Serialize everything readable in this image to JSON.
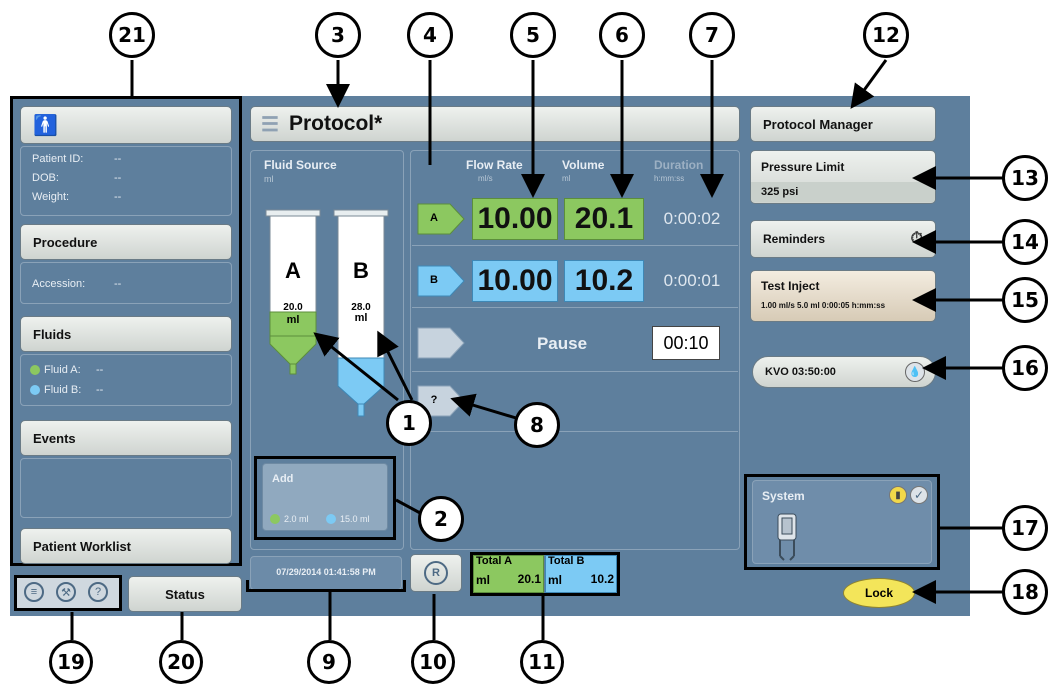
{
  "colors": {
    "screen_bg": "#5e7f9d",
    "fluid_a": "#8cc860",
    "fluid_b": "#7ccaf4",
    "lock": "#f3e55a"
  },
  "callouts": [
    "21",
    "3",
    "4",
    "5",
    "6",
    "7",
    "12",
    "13",
    "14",
    "15",
    "16",
    "17",
    "18",
    "1",
    "8",
    "2",
    "19",
    "20",
    "9",
    "10",
    "11"
  ],
  "header": {
    "title": "Protocol*",
    "protocol_manager": "Protocol Manager"
  },
  "patient": {
    "id_label": "Patient ID:",
    "id_value": "--",
    "dob_label": "DOB:",
    "dob_value": "--",
    "weight_label": "Weight:",
    "weight_value": "--",
    "procedure": "Procedure",
    "accession_label": "Accession:",
    "accession_value": "--",
    "fluids": "Fluids",
    "fluid_a_label": "Fluid A:",
    "fluid_a_value": "--",
    "fluid_b_label": "Fluid B:",
    "fluid_b_value": "--",
    "events": "Events",
    "worklist": "Patient Worklist"
  },
  "fluid_source": {
    "title": "Fluid Source",
    "unit": "ml",
    "syringe_a": {
      "letter": "A",
      "volume": "20.0",
      "unit": "ml",
      "fill_fraction": 0.45
    },
    "syringe_b": {
      "letter": "B",
      "volume": "28.0",
      "unit": "ml",
      "fill_fraction": 0.35
    },
    "add": {
      "label": "Add",
      "a": "2.0 ml",
      "b": "15.0 ml"
    }
  },
  "table": {
    "flow_rate": "Flow Rate",
    "flow_unit": "ml/s",
    "volume": "Volume",
    "volume_unit": "ml",
    "duration": "Duration",
    "duration_unit": "h:mm:ss",
    "row_a": {
      "tag": "A",
      "flow": "10.00",
      "volume": "20.1",
      "duration": "0:00:02"
    },
    "row_b": {
      "tag": "B",
      "flow": "10.00",
      "volume": "10.2",
      "duration": "0:00:01"
    },
    "pause": {
      "label": "Pause",
      "time": "00:10"
    },
    "unknown": {
      "tag": "?"
    }
  },
  "footer": {
    "datetime": "07/29/2014 01:41:58 PM",
    "r": "R",
    "total_a": "Total A",
    "total_a_unit": "ml",
    "total_a_value": "20.1",
    "total_b": "Total B",
    "total_b_unit": "ml",
    "total_b_value": "10.2",
    "status": "Status"
  },
  "right": {
    "pressure_limit": "Pressure Limit",
    "pressure_value": "325 psi",
    "reminders": "Reminders",
    "test_inject": "Test Inject",
    "test_inject_detail": "1.00 ml/s 5.0 ml 0:00:05 h:mm:ss",
    "kvo": "KVO 03:50:00",
    "system": "System",
    "lock": "Lock"
  }
}
